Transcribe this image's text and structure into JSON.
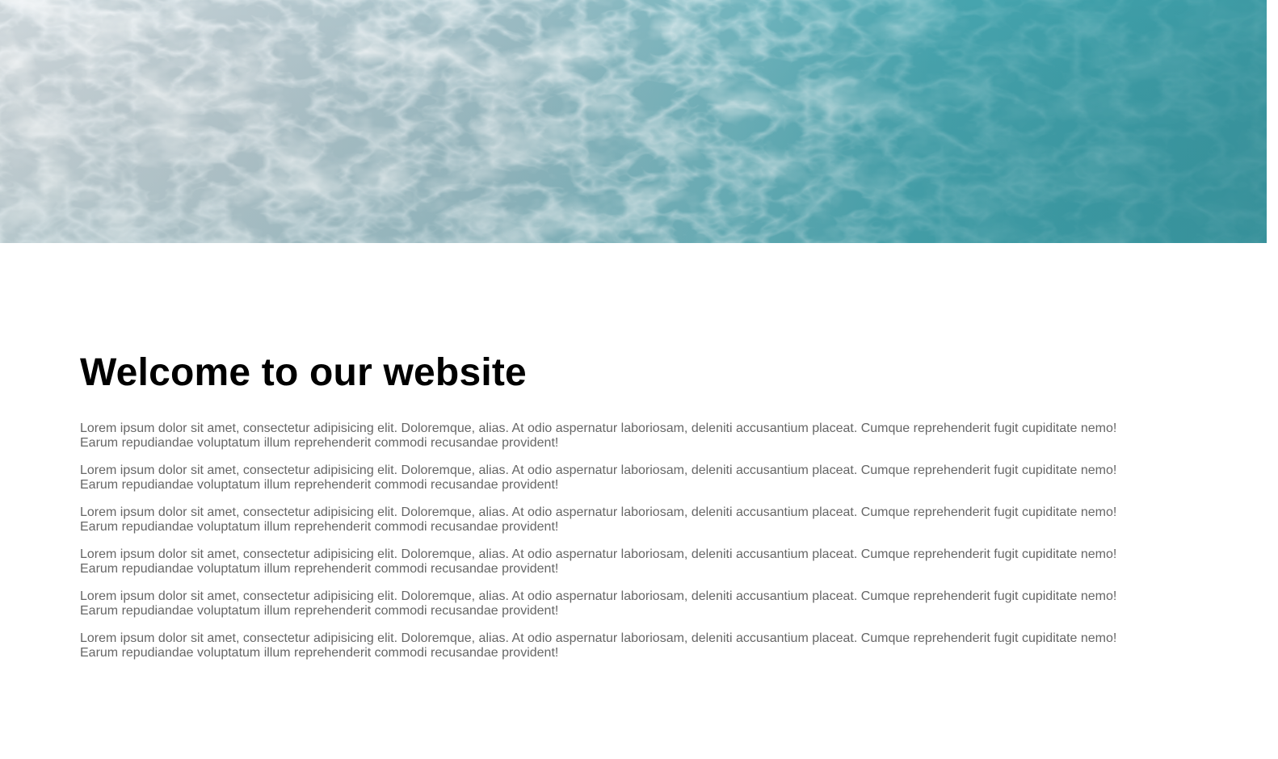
{
  "hero": {
    "image": "ocean-waves-aerial-photo"
  },
  "main": {
    "title": "Welcome to our website",
    "paragraphs": [
      "Lorem ipsum dolor sit amet, consectetur adipisicing elit. Doloremque, alias. At odio aspernatur laboriosam, deleniti accusantium placeat. Cumque reprehenderit fugit cupiditate nemo! Earum repudiandae voluptatum illum reprehenderit commodi recusandae provident!",
      "Lorem ipsum dolor sit amet, consectetur adipisicing elit. Doloremque, alias. At odio aspernatur laboriosam, deleniti accusantium placeat. Cumque reprehenderit fugit cupiditate nemo! Earum repudiandae voluptatum illum reprehenderit commodi recusandae provident!",
      "Lorem ipsum dolor sit amet, consectetur adipisicing elit. Doloremque, alias. At odio aspernatur laboriosam, deleniti accusantium placeat. Cumque reprehenderit fugit cupiditate nemo! Earum repudiandae voluptatum illum reprehenderit commodi recusandae provident!",
      "Lorem ipsum dolor sit amet, consectetur adipisicing elit. Doloremque, alias. At odio aspernatur laboriosam, deleniti accusantium placeat. Cumque reprehenderit fugit cupiditate nemo! Earum repudiandae voluptatum illum reprehenderit commodi recusandae provident!",
      "Lorem ipsum dolor sit amet, consectetur adipisicing elit. Doloremque, alias. At odio aspernatur laboriosam, deleniti accusantium placeat. Cumque reprehenderit fugit cupiditate nemo! Earum repudiandae voluptatum illum reprehenderit commodi recusandae provident!",
      "Lorem ipsum dolor sit amet, consectetur adipisicing elit. Doloremque, alias. At odio aspernatur laboriosam, deleniti accusantium placeat. Cumque reprehenderit fugit cupiditate nemo! Earum repudiandae voluptatum illum reprehenderit commodi recusandae provident!"
    ]
  },
  "colors": {
    "background": "#ffffff",
    "title": "#000000",
    "paragraph": "#666666",
    "water_light": "#cfd8dc",
    "water_deep": "#3a97a1"
  }
}
